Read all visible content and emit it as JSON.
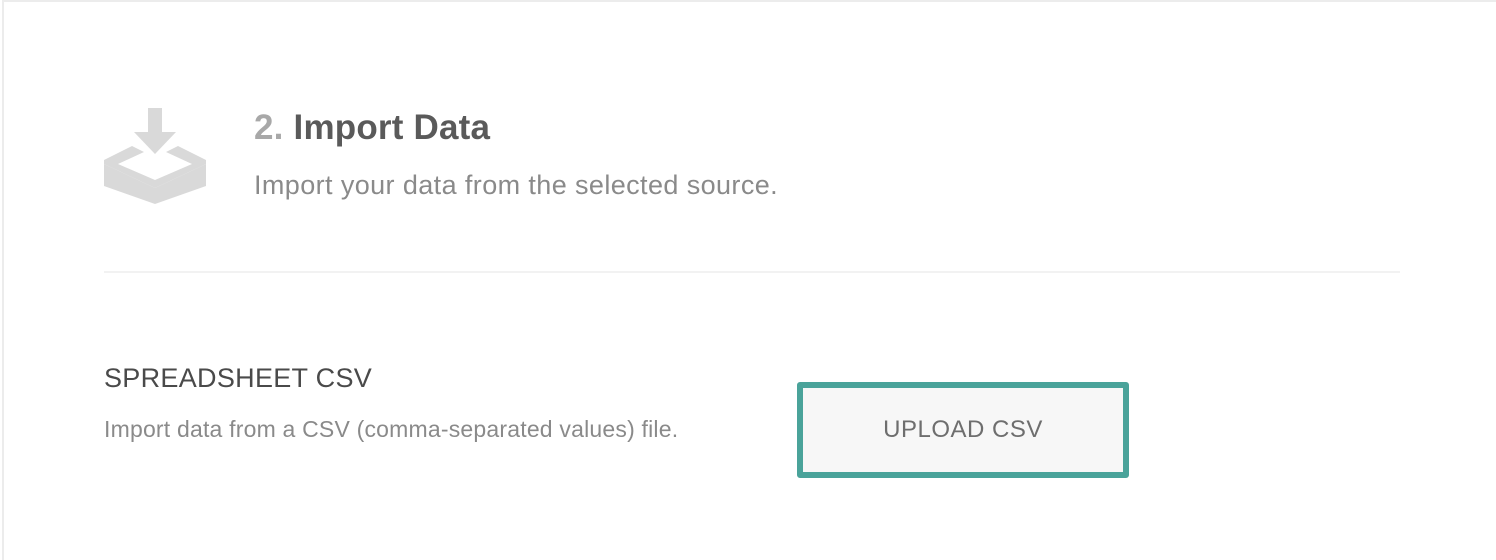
{
  "step": {
    "number": "2.",
    "title": "Import Data",
    "subtitle": "Import your data from the selected source.",
    "icon": "import-tray-icon"
  },
  "source": {
    "title": "SPREADSHEET CSV",
    "description": "Import data from a CSV (comma-separated values) file.",
    "button_label": "UPLOAD CSV"
  },
  "colors": {
    "accent": "#4aa39a",
    "icon": "#d9d9d9",
    "title": "#5a5a5a",
    "muted": "#8a8a8a"
  }
}
